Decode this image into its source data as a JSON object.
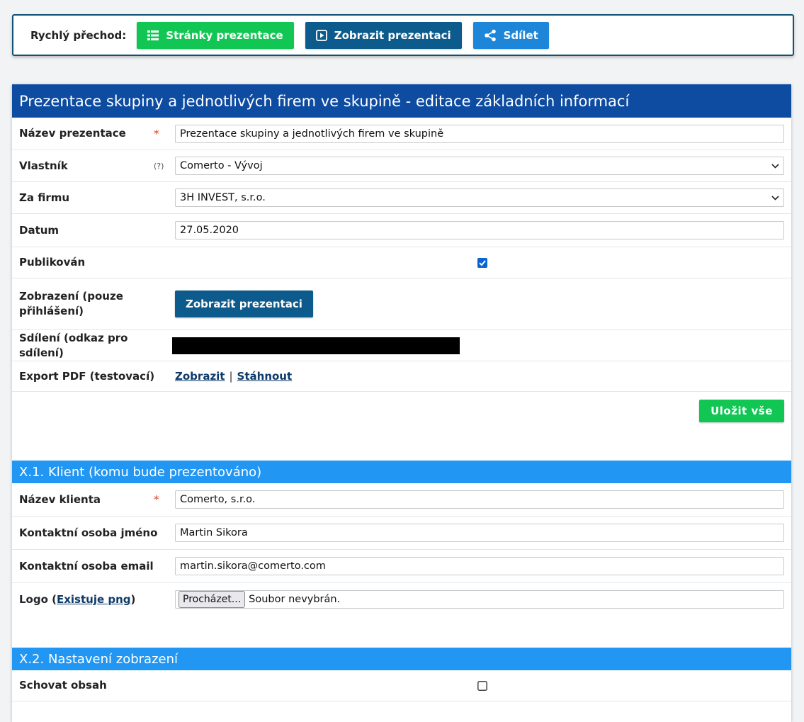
{
  "quickbar": {
    "label": "Rychlý přechod:",
    "btn_pages": "Stránky prezentace",
    "btn_show": "Zobrazit prezentaci",
    "btn_share": "Sdílet"
  },
  "main": {
    "title": "Prezentace skupiny a jednotlivých firem ve skupině - editace základních informací",
    "name_label": "Název prezentace",
    "name_value": "Prezentace skupiny a jednotlivých firem ve skupině",
    "required_mark": "*",
    "owner_label": "Vlastník",
    "owner_help": "(?)",
    "owner_value": "Comerto - Vývoj",
    "company_label": "Za firmu",
    "company_value": "3H INVEST, s.r.o.",
    "date_label": "Datum",
    "date_value": "27.05.2020",
    "published_label": "Publikován",
    "display_label": "Zobrazení (pouze přihlášení)",
    "display_button": "Zobrazit prezentaci",
    "share_label": "Sdílení (odkaz pro sdílení)",
    "export_label": "Export PDF (testovací)",
    "export_view": "Zobrazit",
    "export_sep": "|",
    "export_download": "Stáhnout",
    "save_button": "Uložit vše"
  },
  "client": {
    "title": "X.1. Klient (komu bude prezentováno)",
    "name_label": "Název klienta",
    "name_value": "Comerto, s.r.o.",
    "contact_name_label": "Kontaktní osoba jméno",
    "contact_name_value": "Martin Sikora",
    "contact_email_label": "Kontaktní osoba email",
    "contact_email_value": "martin.sikora@comerto.com",
    "logo_label_prefix": "Logo (",
    "logo_link": "Existuje png",
    "logo_label_suffix": ")",
    "file_button": "Procházet...",
    "file_status": "Soubor nevybrán."
  },
  "display": {
    "title": "X.2. Nastavení zobrazení",
    "hide_label": "Schovat obsah"
  },
  "colors": {
    "header": "#0e4ca2",
    "section": "#2196f3",
    "green": "#11c653",
    "navy": "#0d5b8c",
    "blue": "#1e86d8"
  }
}
